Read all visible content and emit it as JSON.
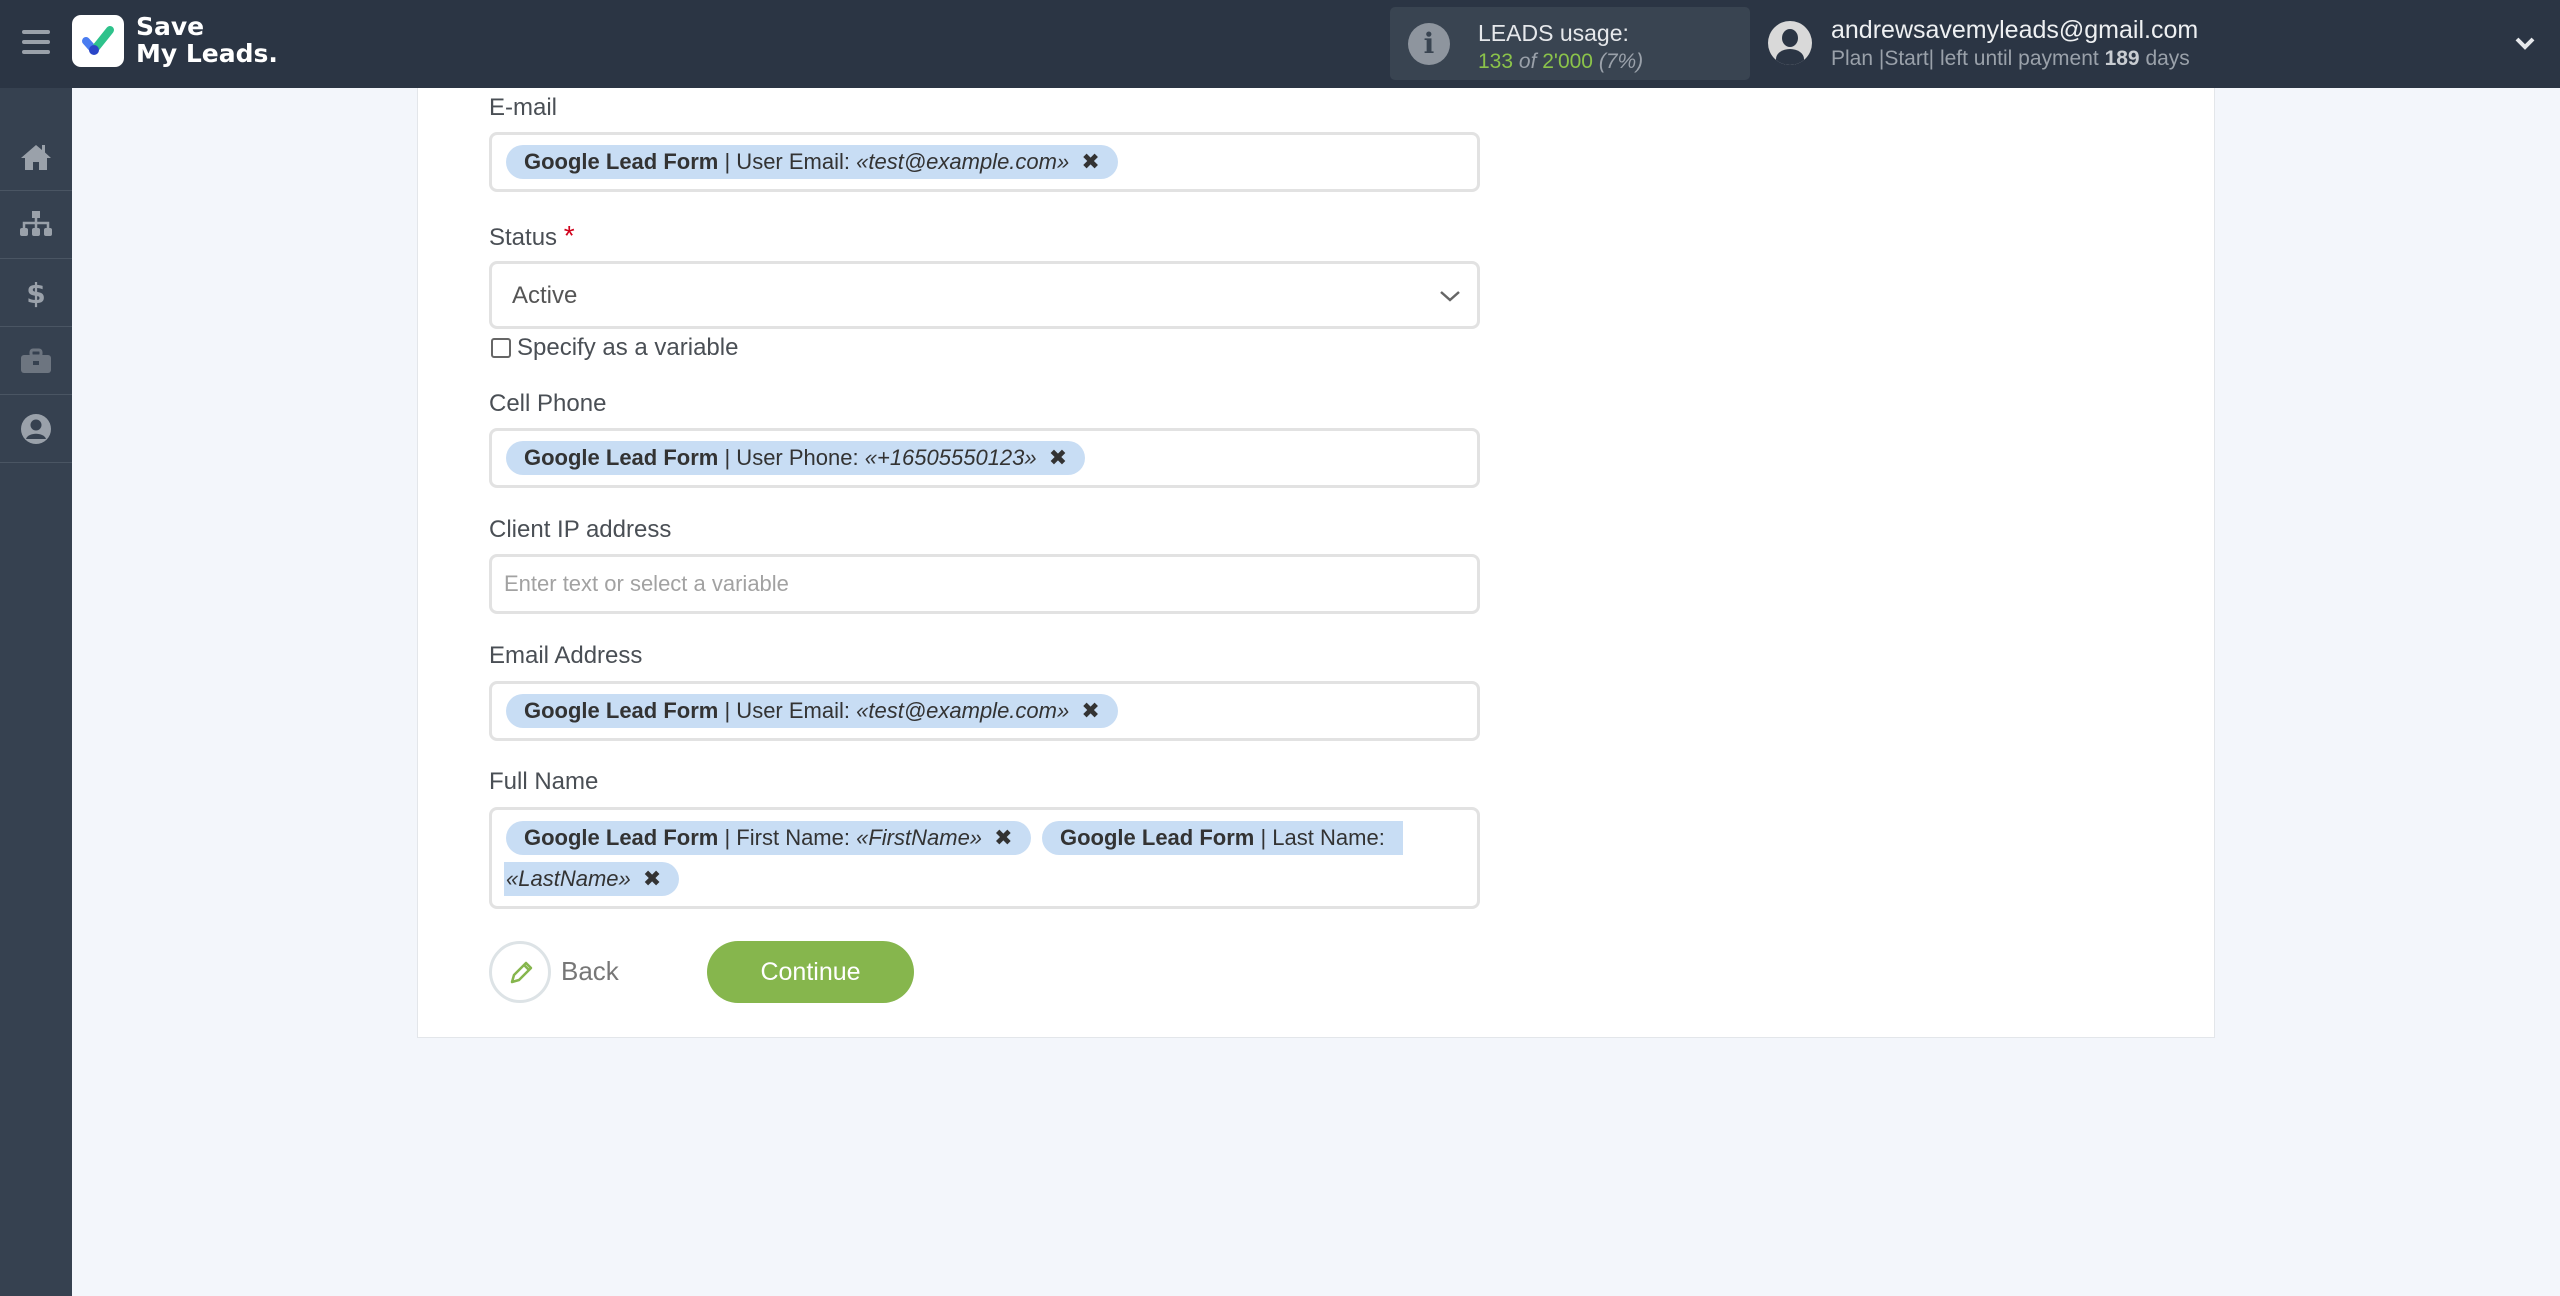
{
  "app": {
    "logo_line1": "Save",
    "logo_line2": "My Leads.",
    "brand_green": "#86b64d",
    "header_bg": "#2b3544"
  },
  "usage": {
    "title": "LEADS usage:",
    "used": "133",
    "of": "of",
    "limit": "2'000",
    "percent": "(7%)"
  },
  "account": {
    "email": "andrewsavemyleads@gmail.com",
    "plan_prefix": "Plan |Start| left until payment",
    "days": "189",
    "days_suffix": "days"
  },
  "sidebar": {
    "items": [
      {
        "name": "home",
        "icon": "home-icon"
      },
      {
        "name": "connections",
        "icon": "sitemap-icon"
      },
      {
        "name": "billing",
        "icon": "dollar-icon"
      },
      {
        "name": "tools",
        "icon": "briefcase-icon"
      },
      {
        "name": "profile",
        "icon": "user-circle-icon"
      }
    ]
  },
  "form": {
    "fields": {
      "email": {
        "label": "E-mail",
        "chips": [
          {
            "source": "Google Lead Form",
            "field": "| User Email:",
            "value": "«test@example.com»",
            "remove": "✖"
          }
        ]
      },
      "status": {
        "label": "Status",
        "required_mark": "*",
        "value": "Active",
        "checkbox_label": "Specify as a variable"
      },
      "cell_phone": {
        "label": "Cell Phone",
        "chips": [
          {
            "source": "Google Lead Form",
            "field": "| User Phone:",
            "value": "«+16505550123»",
            "remove": "✖"
          }
        ]
      },
      "client_ip": {
        "label": "Client IP address",
        "placeholder": "Enter text or select a variable"
      },
      "email_address": {
        "label": "Email Address",
        "chips": [
          {
            "source": "Google Lead Form",
            "field": "| User Email:",
            "value": "«test@example.com»",
            "remove": "✖"
          }
        ]
      },
      "full_name": {
        "label": "Full Name",
        "chips": [
          {
            "source": "Google Lead Form",
            "field": "| First Name:",
            "value": "«FirstName»",
            "remove": "✖"
          },
          {
            "source": "Google Lead Form",
            "field": "| Last Name:",
            "value": "«LastName»",
            "remove": "✖"
          }
        ]
      }
    },
    "back_label": "Back",
    "continue_label": "Continue"
  }
}
